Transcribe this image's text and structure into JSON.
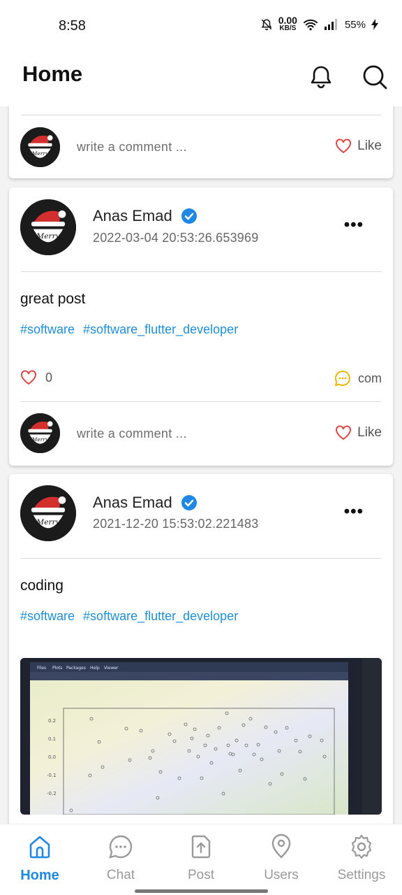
{
  "status_bar": {
    "time": "8:58",
    "net_speed": "0.00",
    "net_unit": "KB/S",
    "battery": "55%"
  },
  "app_bar": {
    "title": "Home",
    "icons": [
      "bell-icon",
      "search-icon"
    ]
  },
  "feed": {
    "comment_placeholder": "write a comment ...",
    "like_label": "Like",
    "posts": [
      {
        "author": "Anas Emad",
        "verified": true,
        "date": "2022-03-04 20:53:26.653969",
        "text": "great post",
        "tags": [
          "#software",
          "#software_flutter_developer"
        ],
        "likes": "0",
        "comment_label": "com"
      },
      {
        "author": "Anas Emad",
        "verified": true,
        "date": "2021-12-20 15:53:02.221483",
        "text": "coding",
        "tags": [
          "#software",
          "#software_flutter_developer"
        ],
        "image": "photo of a scatter plot on a computer screen (RStudio Plots pane)",
        "image_tabs": [
          "Files",
          "Plots",
          "Packages",
          "Help",
          "Viewer"
        ],
        "image_axis_ticks": [
          "0.2",
          "0.1",
          "0.0",
          "-0.1",
          "-0.2"
        ]
      }
    ]
  },
  "bottom_nav": {
    "items": [
      {
        "label": "Home",
        "icon": "home-icon",
        "active": true
      },
      {
        "label": "Chat",
        "icon": "chat-icon",
        "active": false
      },
      {
        "label": "Post",
        "icon": "post-upload-icon",
        "active": false
      },
      {
        "label": "Users",
        "icon": "location-pin-icon",
        "active": false
      },
      {
        "label": "Settings",
        "icon": "gear-icon",
        "active": false
      }
    ]
  },
  "colors": {
    "accent": "#1e88e5",
    "hashtag": "#1e8fd6",
    "heart": "#e04646",
    "comment_icon": "#f2b705",
    "verified": "#1e88e5"
  }
}
